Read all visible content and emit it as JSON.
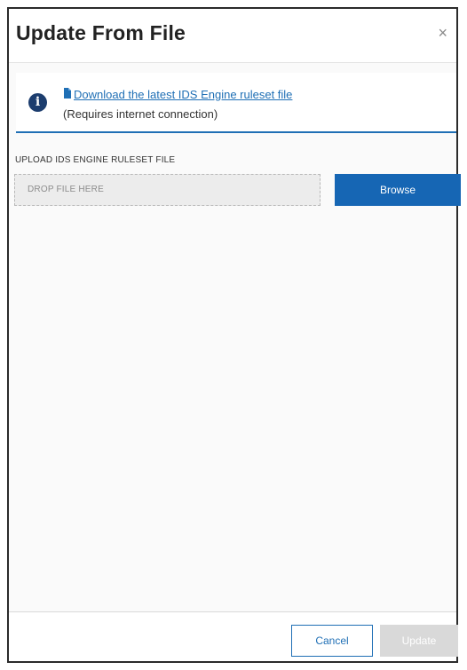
{
  "dialog": {
    "title": "Update From File",
    "close_glyph": "×"
  },
  "info": {
    "icon": "info-icon",
    "download_link": "Download the latest IDS Engine ruleset file",
    "download_icon": "file-icon",
    "requires_text": "(Requires internet connection)"
  },
  "upload": {
    "label": "UPLOAD IDS ENGINE RULESET FILE",
    "drop_placeholder": "DROP FILE HERE",
    "browse_label": "Browse"
  },
  "footer": {
    "cancel_label": "Cancel",
    "update_label": "Update",
    "update_enabled": false
  },
  "colors": {
    "accent": "#1666b4",
    "link": "#1f6fb5",
    "disabled": "#d9d9d9"
  }
}
